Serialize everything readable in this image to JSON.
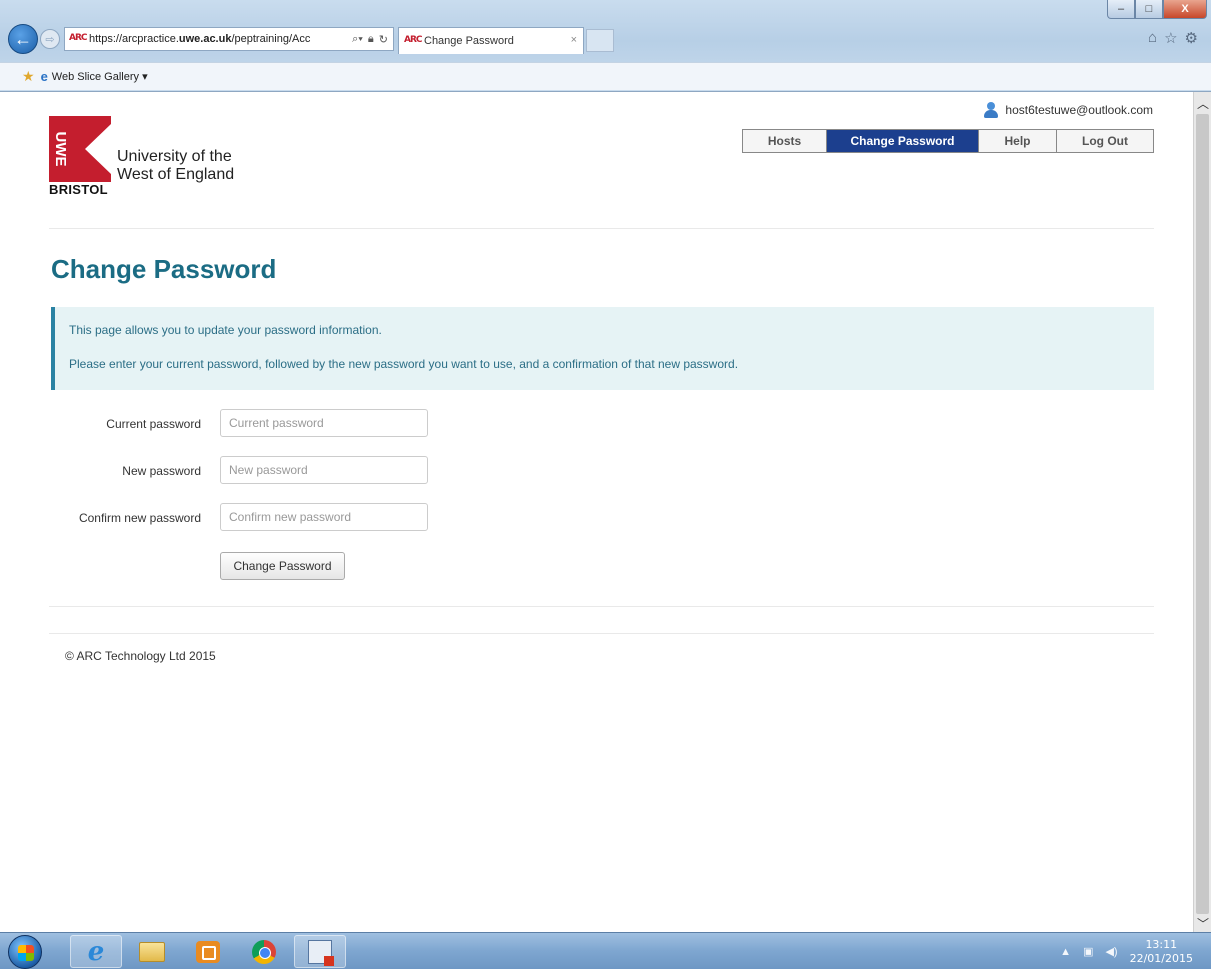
{
  "browser": {
    "address_prefix": "https://arcpractice.",
    "address_domain": "uwe.ac.uk",
    "address_path": "/peptraining/Acc",
    "site_icon_text": "ARC",
    "tab_title": "Change Password",
    "tab_close": "×",
    "favorites_item": "Web Slice Gallery ▾",
    "icons": [
      "back-icon",
      "forward-icon",
      "search-icon",
      "lock-icon",
      "refresh-icon",
      "home-icon",
      "favorites-star-icon",
      "settings-gear-icon"
    ]
  },
  "window": {
    "minimize": "–",
    "maximize": "□",
    "close": "X"
  },
  "header": {
    "user_email": "host6testuwe@outlook.com",
    "logo_line1": "University of the",
    "logo_line2": "West of England",
    "logo_bristol": "BRISTOL",
    "logo_mark_text": "UWE"
  },
  "nav": {
    "hosts": "Hosts",
    "change_password": "Change Password",
    "help": "Help",
    "log_out": "Log Out",
    "active": "change_password"
  },
  "main": {
    "title": "Change Password",
    "info_line1": "This page allows you to update your password information.",
    "info_line2": "Please enter your current password, followed by the new password you want to use, and a confirmation of that new password."
  },
  "form": {
    "current_label": "Current password",
    "current_placeholder": "Current password",
    "current_value": "",
    "new_label": "New password",
    "new_placeholder": "New password",
    "new_value": "",
    "confirm_label": "Confirm new password",
    "confirm_placeholder": "Confirm new password",
    "confirm_value": "",
    "submit_label": "Change Password"
  },
  "footer": {
    "copyright": "© ARC Technology Ltd 2015"
  },
  "taskbar": {
    "time": "13:11",
    "date": "22/01/2015",
    "tray_icons": [
      "show-hidden-icon",
      "network-icon",
      "volume-icon"
    ]
  },
  "colors": {
    "nav_active": "#1c3f8e",
    "title": "#1b6c84",
    "info_bg": "#e6f3f5",
    "info_border": "#2a82a3",
    "logo_red": "#c41e2e"
  }
}
